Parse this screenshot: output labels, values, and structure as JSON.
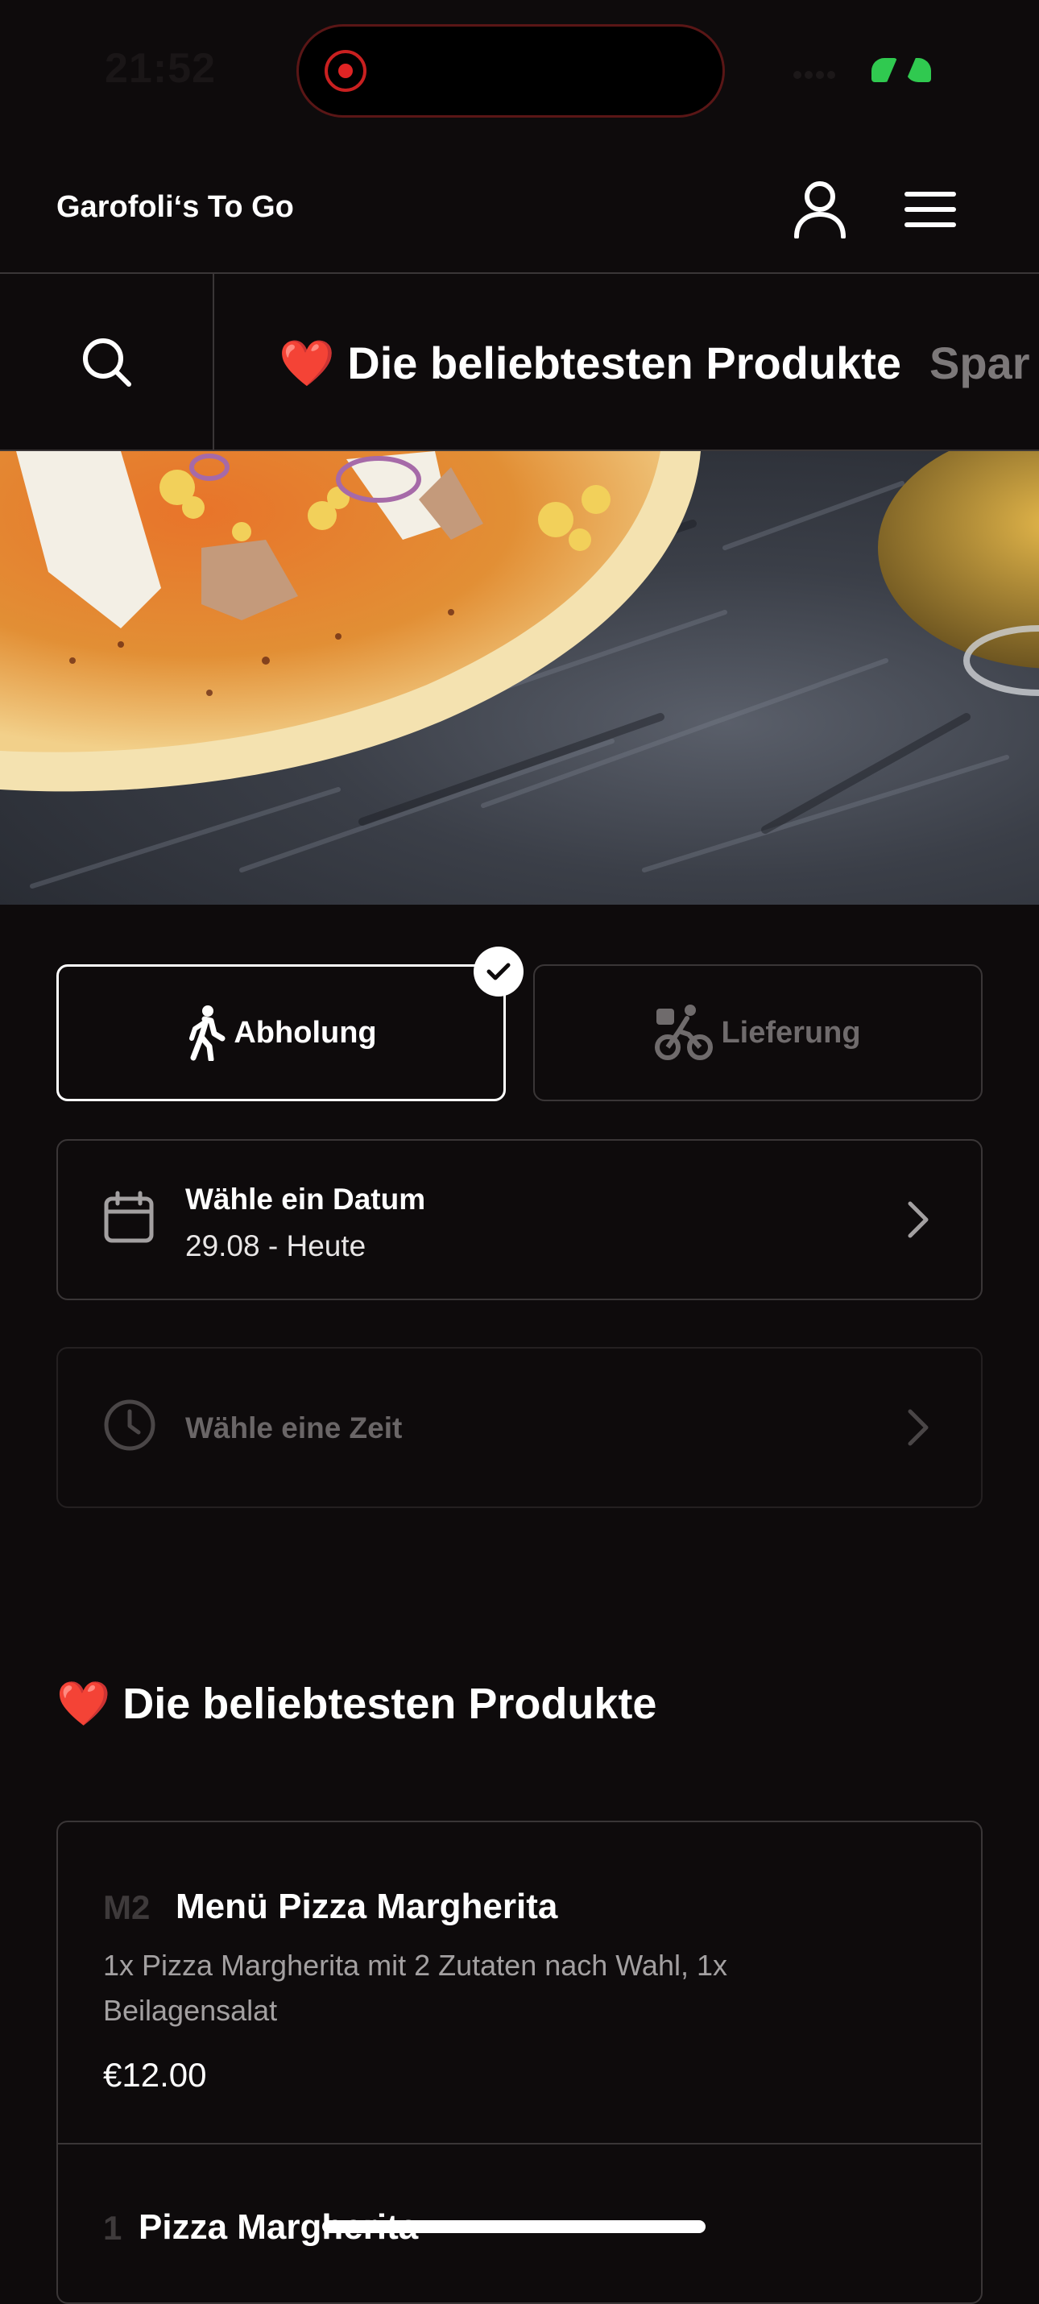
{
  "status_bar": {
    "time": "21:52"
  },
  "header": {
    "brand": "Garofoli‘s To Go",
    "account_icon": "person-icon",
    "menu_icon": "hamburger-menu-icon"
  },
  "category_nav": {
    "search_icon": "search-icon",
    "tabs": [
      {
        "label": "❤️ Die beliebtesten Produkte",
        "active": true
      },
      {
        "label": "Spar",
        "active": false
      }
    ]
  },
  "order_mode": {
    "options": [
      {
        "label": "Abholung",
        "icon": "walking-person-icon",
        "selected": true
      },
      {
        "label": "Lieferung",
        "icon": "bicycle-delivery-icon",
        "selected": false
      }
    ],
    "selected_indicator_icon": "checkmark-icon"
  },
  "date_picker": {
    "title": "Wähle ein Datum",
    "value": "29.08 - Heute",
    "icon": "calendar-icon"
  },
  "time_picker": {
    "title": "Wähle eine Zeit",
    "icon": "clock-icon",
    "enabled": false
  },
  "section": {
    "title": "❤️ Die beliebtesten Produkte"
  },
  "products": [
    {
      "code": "M2",
      "name": "Menü Pizza Margherita",
      "description": "1x Pizza Margherita mit 2 Zutaten nach Wahl, 1x Beilagensalat",
      "price": "€12.00"
    },
    {
      "code": "1",
      "name": "Pizza Margherita"
    }
  ],
  "colors": {
    "background": "#0e0b0c",
    "border": "#3a3637",
    "muted_text": "#a3a0a1",
    "disabled_text": "#6a6667",
    "recording_red": "#e02424",
    "battery_green": "#30c950"
  }
}
